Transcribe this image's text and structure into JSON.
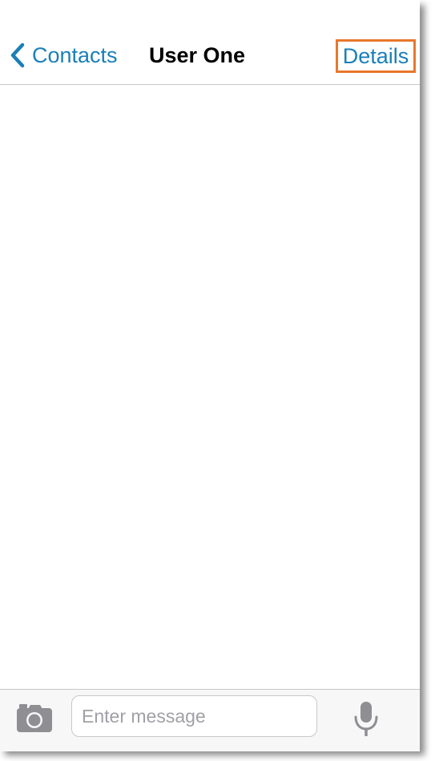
{
  "navbar": {
    "back_label": "Contacts",
    "title": "User One",
    "details_label": "Details"
  },
  "composer": {
    "placeholder": "Enter message",
    "value": ""
  },
  "icons": {
    "back": "chevron-left-icon",
    "camera": "camera-icon",
    "microphone": "microphone-icon"
  },
  "colors": {
    "accent": "#1a7fb8",
    "highlight": "#e8782a",
    "icon_gray": "#8e8e93"
  }
}
